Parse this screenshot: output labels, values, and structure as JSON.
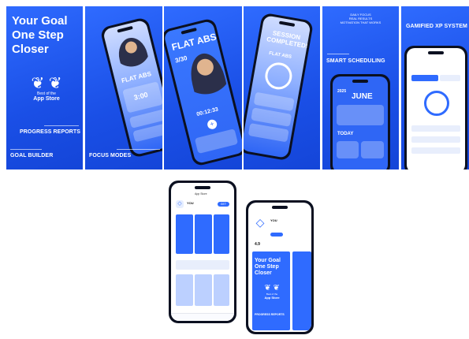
{
  "panels": {
    "p1": {
      "headline": [
        "Your Goal",
        "One Step",
        "Closer"
      ],
      "badge_small": "Best of the",
      "badge_big": "App Store",
      "caption_mid": "PROGRESS REPORTS",
      "caption_bottom": "GOAL BUILDER"
    },
    "p2": {
      "caption": "FOCUS MODES",
      "screen_title": "FLAT ABS",
      "timer": "3:00"
    },
    "p3": {
      "screen_title": "FLAT ABS",
      "count": "3/30",
      "timer": "00:12:33"
    },
    "p4": {
      "screen_title": "SESSION COMPLETED!",
      "subtitle": "FLAT ABS"
    },
    "p5": {
      "top_lines": [
        "DAILY FOCUS",
        "REAL RESULTS",
        "MOTIVATION THAT WORKS"
      ],
      "caption": "SMART SCHEDULING",
      "month": "JUNE",
      "year": "2025",
      "today": "TODAY"
    },
    "p6": {
      "caption": "GAMIFIED XP SYSTEM"
    }
  },
  "app_store_phone": {
    "search_label": "App Store",
    "app_name": "YOU",
    "get_label": "GET"
  },
  "promo_phone": {
    "app_name": "YOU",
    "headline": [
      "Your Goal",
      "One Step",
      "Closer"
    ],
    "badge_small": "Best of the",
    "badge_big": "App Store",
    "caption": "PROGRESS REPORTS",
    "rating": "4.9"
  }
}
